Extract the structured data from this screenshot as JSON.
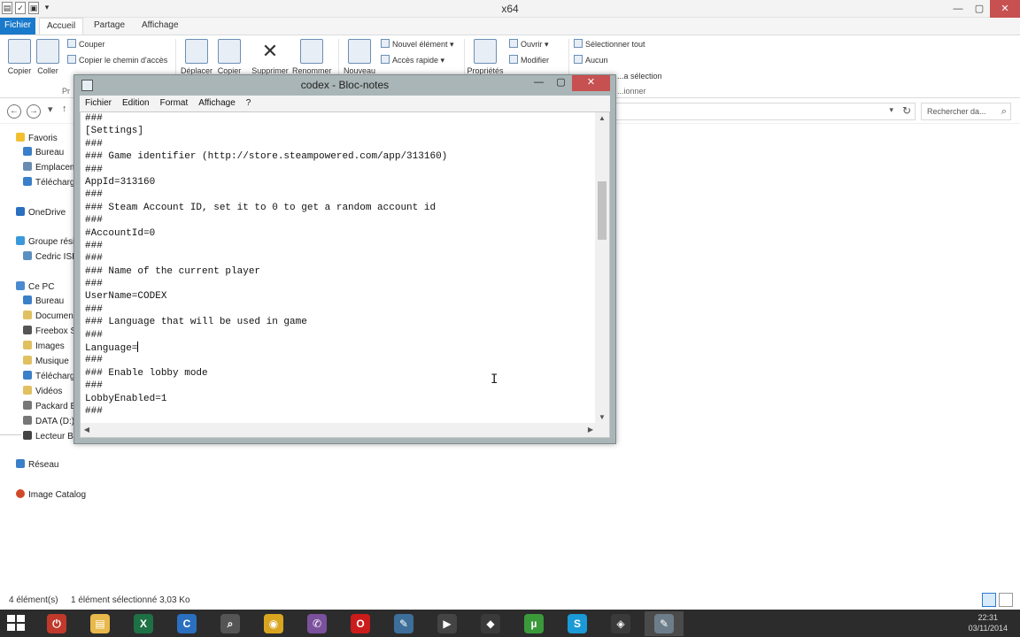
{
  "explorer": {
    "window_title": "x64",
    "ribbon_tabs": [
      "Fichier",
      "Accueil",
      "Partage",
      "Affichage"
    ],
    "clipboard": {
      "copy_label": "Copier",
      "paste_label": "Coller",
      "cut_label": "Couper",
      "copy_path_label": "Copier le chemin d'accès",
      "group_label": "Pr"
    },
    "organize": {
      "move_label": "Déplacer",
      "copy_to_label": "Copier",
      "delete_label": "Supprimer",
      "rename_label": "Renommer"
    },
    "new": {
      "new_folder_label": "Nouveau",
      "new_item_label": "Nouvel élément ▾",
      "easy_access_label": "Accès rapide ▾"
    },
    "open": {
      "properties_label": "Propriétés",
      "open_label": "Ouvrir ▾",
      "edit_label": "Modifier"
    },
    "select": {
      "select_all_label": "Sélectionner tout",
      "none_label": "Aucun",
      "invert_label": "...a sélection",
      "group_label": "...ionner"
    },
    "search_placeholder": "Rechercher da...",
    "nav_pane": {
      "favorites": "Favoris",
      "favorites_items": [
        "Bureau",
        "Emplacem...",
        "Télécharg..."
      ],
      "onedrive": "OneDrive",
      "homegroup": "Groupe rési...",
      "homegroup_items": [
        "Cedric ISID..."
      ],
      "this_pc": "Ce PC",
      "this_pc_items": [
        "Bureau",
        "Documen...",
        "Freebox Se...",
        "Images",
        "Musique",
        "Télécharg...",
        "Vidéos",
        "Packard B...",
        "DATA (D:)",
        "Lecteur B..."
      ],
      "network": "Réseau",
      "image_catalog": "Image Catalog"
    },
    "status": {
      "item_count": "4 élément(s)",
      "selection": "1 élément sélectionné  3,03 Ko"
    }
  },
  "notepad": {
    "title": "codex - Bloc-notes",
    "menu": [
      "Fichier",
      "Edition",
      "Format",
      "Affichage",
      "?"
    ],
    "lines": [
      "###",
      "[Settings]",
      "###",
      "### Game identifier (http://store.steampowered.com/app/313160)",
      "###",
      "AppId=313160",
      "###",
      "### Steam Account ID, set it to 0 to get a random account id",
      "###",
      "#AccountId=0",
      "###",
      "###",
      "### Name of the current player",
      "###",
      "UserName=CODEX",
      "###",
      "### Language that will be used in game",
      "###",
      "Language=",
      "###",
      "### Enable lobby mode",
      "###",
      "LobbyEnabled=1",
      "###"
    ],
    "caret_line_index": 18
  },
  "taskbar": {
    "apps": [
      "power-app-icon",
      "file-explorer-icon",
      "excel-icon",
      "ccleaner-icon",
      "magnifier-icon",
      "chrome-icon",
      "viber-icon",
      "opera-icon",
      "draw-app-icon",
      "media-app-icon",
      "game-app-icon",
      "utorrent-icon",
      "skype-icon",
      "app-icon",
      "notepad-icon"
    ],
    "clock_time": "22:31",
    "clock_date": "03/11/2014"
  }
}
